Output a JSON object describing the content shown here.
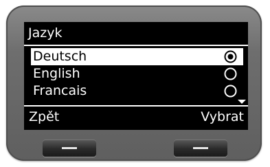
{
  "screen": {
    "title": "Jazyk",
    "options": [
      {
        "label": "Deutsch",
        "selected": true
      },
      {
        "label": "English",
        "selected": false
      },
      {
        "label": "Francais",
        "selected": false
      }
    ],
    "more_below_indicator": "scroll-down-arrow-icon",
    "softkeys": {
      "left": "Zpět",
      "right": "Vybrat"
    }
  },
  "colors": {
    "screen_bg": "#000000",
    "text": "#ffffff",
    "highlight_bg": "#ffffff",
    "highlight_text": "#000000",
    "bezel": "#6e6e6e"
  }
}
